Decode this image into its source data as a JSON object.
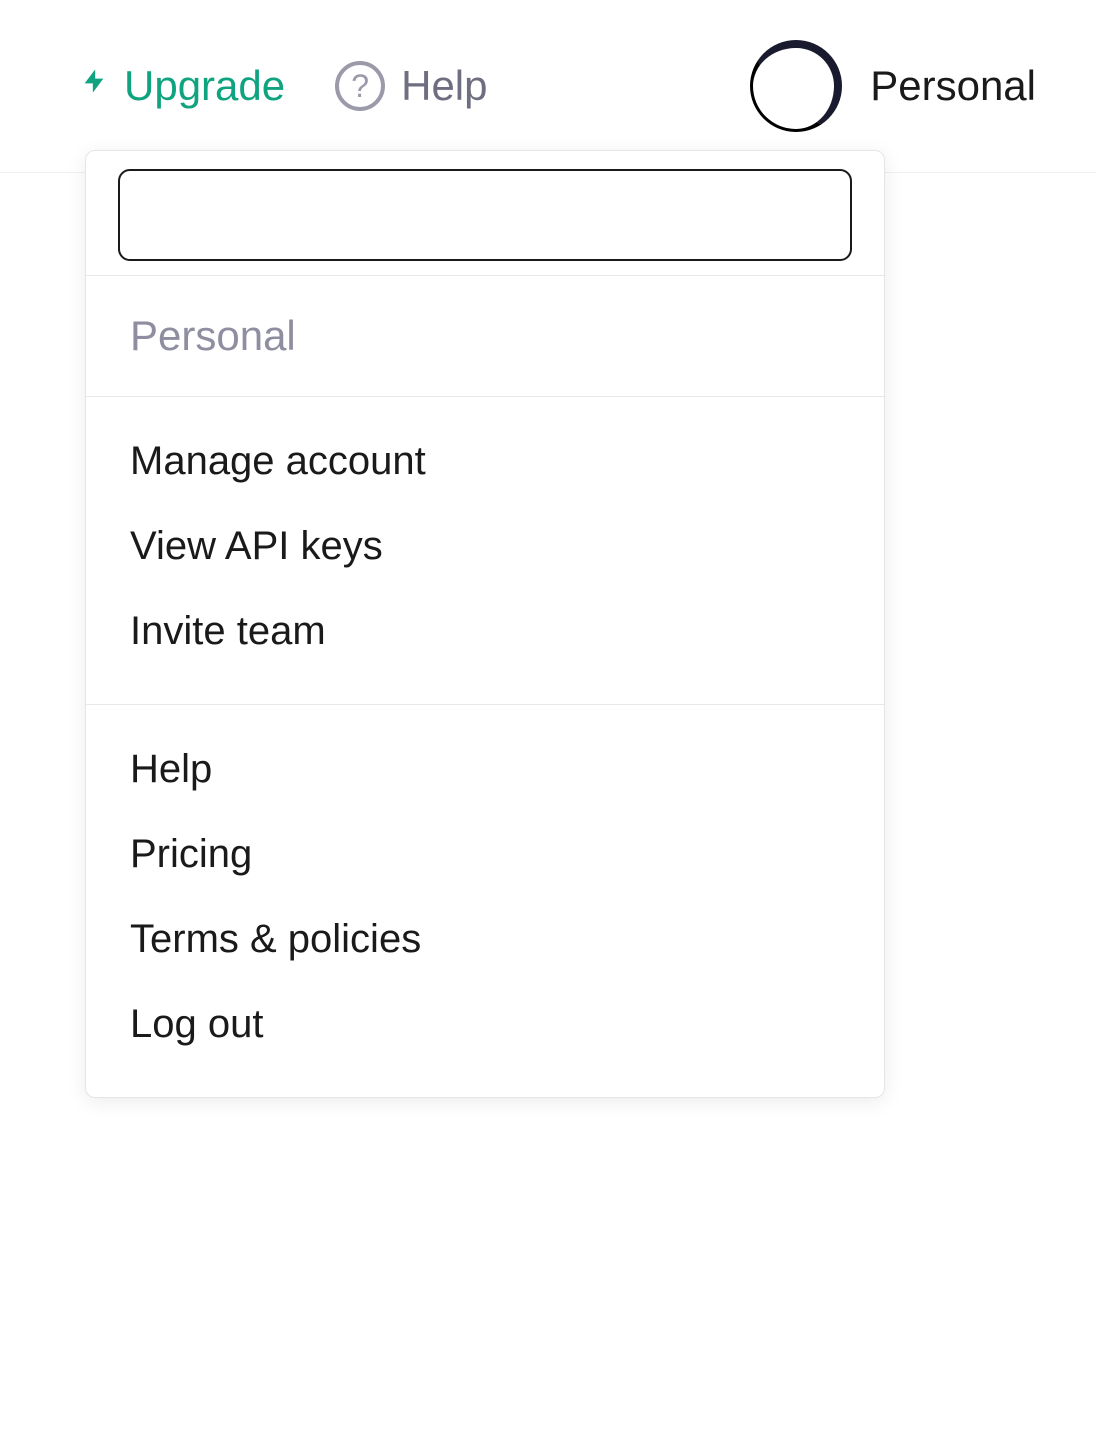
{
  "topbar": {
    "upgrade_label": "Upgrade",
    "help_label": "Help",
    "account_label": "Personal"
  },
  "dropdown": {
    "search_value": "",
    "workspace_header": "Personal",
    "account_items": [
      "Manage account",
      "View API keys",
      "Invite team"
    ],
    "footer_items": [
      "Help",
      "Pricing",
      "Terms & policies",
      "Log out"
    ]
  },
  "colors": {
    "accent": "#10a37f",
    "muted": "#8e8ea0",
    "text": "#1a1a1a",
    "border": "#e5e5e5"
  }
}
